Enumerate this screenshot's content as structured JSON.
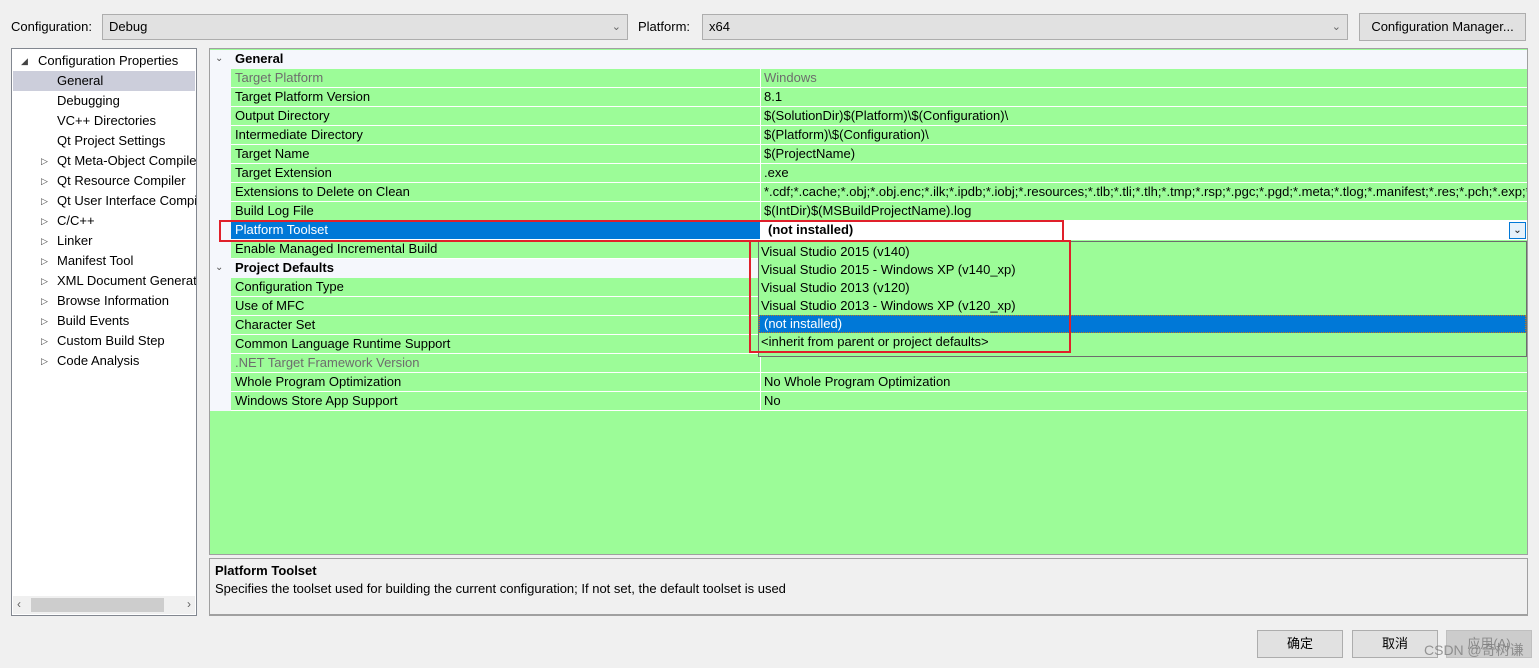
{
  "toolbar": {
    "configuration_label": "Configuration:",
    "configuration_value": "Debug",
    "platform_label": "Platform:",
    "platform_value": "x64",
    "config_manager_button": "Configuration Manager..."
  },
  "tree": {
    "root": "Configuration Properties",
    "items": [
      {
        "label": "General",
        "expandable": false,
        "selected": true
      },
      {
        "label": "Debugging",
        "expandable": false
      },
      {
        "label": "VC++ Directories",
        "expandable": false
      },
      {
        "label": "Qt Project Settings",
        "expandable": false
      },
      {
        "label": "Qt Meta-Object Compiler",
        "expandable": true
      },
      {
        "label": "Qt Resource Compiler",
        "expandable": true
      },
      {
        "label": "Qt User Interface Compiler",
        "expandable": true
      },
      {
        "label": "C/C++",
        "expandable": true
      },
      {
        "label": "Linker",
        "expandable": true
      },
      {
        "label": "Manifest Tool",
        "expandable": true
      },
      {
        "label": "XML Document Generator",
        "expandable": true
      },
      {
        "label": "Browse Information",
        "expandable": true
      },
      {
        "label": "Build Events",
        "expandable": true
      },
      {
        "label": "Custom Build Step",
        "expandable": true
      },
      {
        "label": "Code Analysis",
        "expandable": true
      }
    ]
  },
  "grid": {
    "sections": [
      {
        "title": "General",
        "rows": [
          {
            "name": "Target Platform",
            "value": "Windows",
            "disabled": true
          },
          {
            "name": "Target Platform Version",
            "value": "8.1"
          },
          {
            "name": "Output Directory",
            "value": "$(SolutionDir)$(Platform)\\$(Configuration)\\"
          },
          {
            "name": "Intermediate Directory",
            "value": "$(Platform)\\$(Configuration)\\"
          },
          {
            "name": "Target Name",
            "value": "$(ProjectName)"
          },
          {
            "name": "Target Extension",
            "value": ".exe"
          },
          {
            "name": "Extensions to Delete on Clean",
            "value": "*.cdf;*.cache;*.obj;*.obj.enc;*.ilk;*.ipdb;*.iobj;*.resources;*.tlb;*.tli;*.tlh;*.tmp;*.rsp;*.pgc;*.pgd;*.meta;*.tlog;*.manifest;*.res;*.pch;*.exp;*.idb;*.rep;*.xdc;*.pdb;*_manifest.rc;*.bsc;*.sbr;*.xml;*.metagen;*.bi"
          },
          {
            "name": "Build Log File",
            "value": "$(IntDir)$(MSBuildProjectName).log"
          },
          {
            "name": "Platform Toolset",
            "value": "(not installed)",
            "selected": true
          },
          {
            "name": "Enable Managed Incremental Build",
            "value": ""
          }
        ]
      },
      {
        "title": "Project Defaults",
        "rows": [
          {
            "name": "Configuration Type",
            "value": ""
          },
          {
            "name": "Use of MFC",
            "value": ""
          },
          {
            "name": "Character Set",
            "value": ""
          },
          {
            "name": "Common Language Runtime Support",
            "value": ""
          },
          {
            "name": ".NET Target Framework Version",
            "value": "",
            "disabled": true
          },
          {
            "name": "Whole Program Optimization",
            "value": "No Whole Program Optimization"
          },
          {
            "name": "Windows Store App Support",
            "value": "No"
          }
        ]
      }
    ]
  },
  "toolset_dropdown": {
    "options": [
      "Visual Studio 2015 (v140)",
      "Visual Studio 2015 - Windows XP (v140_xp)",
      "Visual Studio 2013 (v120)",
      "Visual Studio 2013 - Windows XP (v120_xp)",
      "(not installed)",
      "<inherit from parent or project defaults>"
    ],
    "selected_index": 4
  },
  "description": {
    "title": "Platform Toolset",
    "text": "Specifies the toolset used for building the current configuration; If not set, the default toolset is used"
  },
  "buttons": {
    "ok": "确定",
    "cancel": "取消",
    "apply": "应用(A)"
  },
  "watermark": "CSDN @奇树谦",
  "colors": {
    "grid_bg": "#9cfc98",
    "selection": "#0078d7",
    "highlight_box": "#e0202a"
  }
}
